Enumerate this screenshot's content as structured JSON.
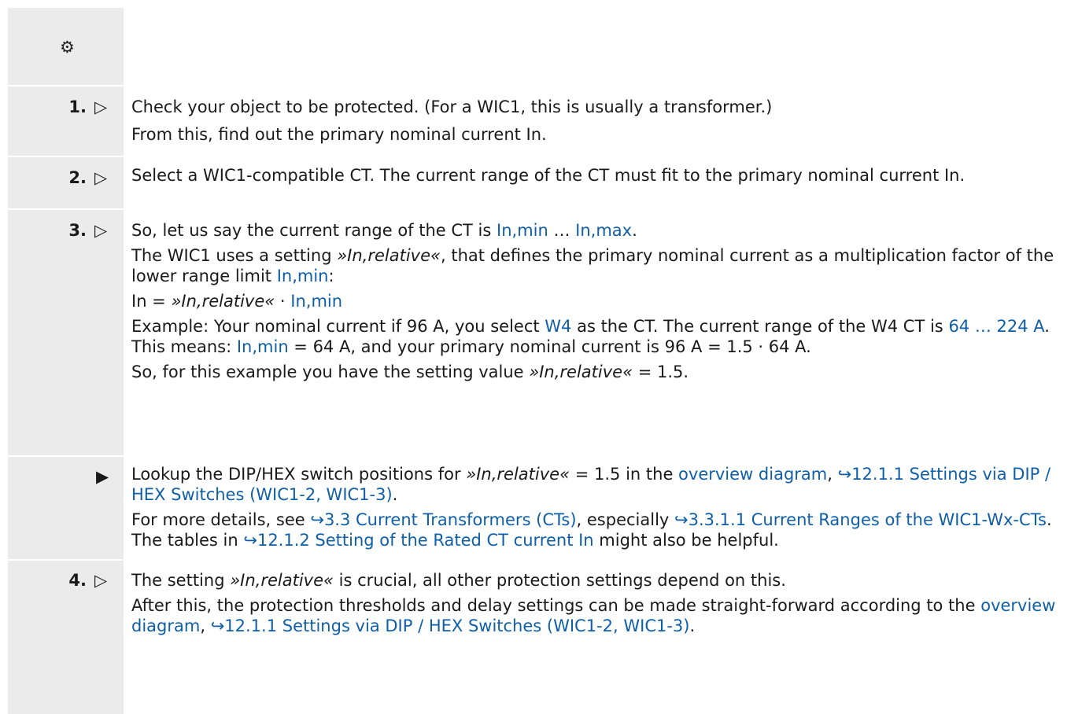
{
  "gear_icon": "⚙",
  "steps": [
    {
      "number": "1.",
      "marker": "▷",
      "lines": [
        "Check your object to be protected. (For a WIC1, this is usually a transformer.)",
        "From this, find out the primary nominal current In."
      ]
    },
    {
      "number": "2.",
      "marker": "▷",
      "lines": [
        "Select a WIC1-compatible CT. The current range of the CT must fit to the primary nominal current In."
      ]
    },
    {
      "number": "3.",
      "marker": "▷",
      "l1_a": "So, let us say the current range of the CT is ",
      "l1_link1": "In,min",
      "l1_b": " … ",
      "l1_link2": "In,max",
      "l1_c": ".",
      "l2_a": "The WIC1 uses a setting ",
      "l2_em": "»In,relative«",
      "l2_b": ", that defines the primary nominal current as a multiplication factor of the lower range limit ",
      "l2_link": "In,min",
      "l2_c": ":",
      "l3_a": "In = ",
      "l3_em": "»In,relative«",
      "l3_b": " · ",
      "l3_link": "In,min",
      "l4_a": "Example: Your nominal current if 96 A, you select ",
      "l4_link1": "W4",
      "l4_b": " as the CT. The current range of the W4 CT is ",
      "l4_link2": "64 … 224 A",
      "l4_c": ". This means: ",
      "l4_link3": "In,min",
      "l4_d": " = 64 A, and your primary nominal current is 96 A = 1.5 · 64 A.",
      "l5_a": "So, for this example you have the setting value ",
      "l5_em": "»In,relative«",
      "l5_b": " = 1.5."
    },
    {
      "marker": "▶",
      "l1_a": "Lookup the DIP/HEX switch positions for ",
      "l1_em": "»In,relative«",
      "l1_b": " = 1.5 in the ",
      "l1_link1": "overview diagram",
      "l1_c": ", ",
      "l1_link2": "↪12.1.1 Settings via DIP / HEX Switches (WIC1-2, WIC1-3)",
      "l1_d": ".",
      "l2_a": "For more details, see ",
      "l2_link1": "↪3.3 Current Transformers (CTs)",
      "l2_b": ", especially ",
      "l2_link2": "↪3.3.1.1 Current Ranges of the WIC1-Wx-CTs",
      "l2_c": ". The tables in ",
      "l2_link3": "↪12.1.2 Setting of the Rated CT current In",
      "l2_d": " might also be helpful."
    },
    {
      "number": "4.",
      "marker": "▷",
      "l1_a": "The setting ",
      "l1_em": "»In,relative«",
      "l1_b": " is crucial, all other protection settings depend on this.",
      "l2_a": "After this, the protection thresholds and delay settings can be made straight-forward according to the ",
      "l2_link1": "overview diagram",
      "l2_b": ", ",
      "l2_link2": "↪12.1.1 Settings via DIP / HEX Switches (WIC1-2, WIC1-3)",
      "l2_c": "."
    }
  ]
}
